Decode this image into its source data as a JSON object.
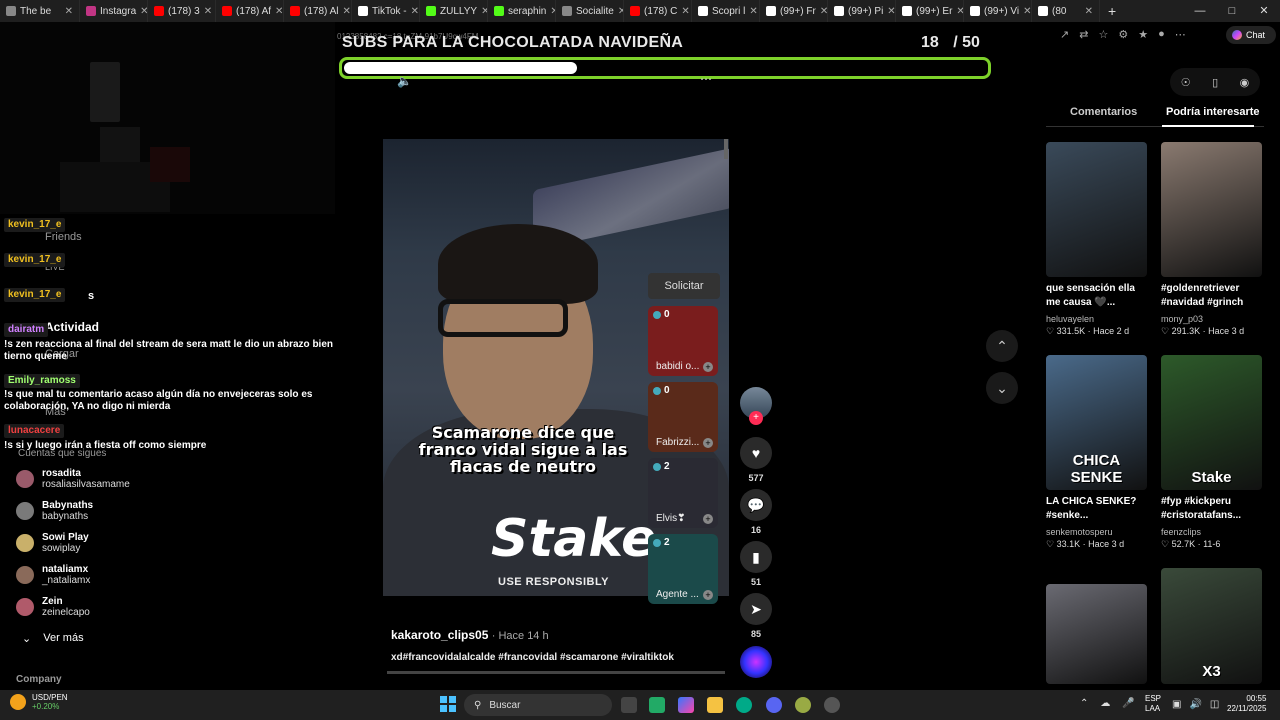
{
  "browser": {
    "tabs": [
      {
        "label": "The be",
        "color": "#888"
      },
      {
        "label": "Instagra",
        "color": "#c13584"
      },
      {
        "label": "(178) 3",
        "color": "#f00"
      },
      {
        "label": "(178) Af",
        "color": "#f00"
      },
      {
        "label": "(178) Al",
        "color": "#f00"
      },
      {
        "label": "TikTok -",
        "color": "#fff"
      },
      {
        "label": "ZULLYY",
        "color": "#53fc18"
      },
      {
        "label": "seraphin",
        "color": "#53fc18"
      },
      {
        "label": "Socialite",
        "color": "#888"
      },
      {
        "label": "(178) C",
        "color": "#f00"
      },
      {
        "label": "Scopri l",
        "color": "#fff"
      },
      {
        "label": "(99+) Fr",
        "color": "#fff"
      },
      {
        "label": "(99+) Pi",
        "color": "#fff"
      },
      {
        "label": "(99+) Er",
        "color": "#fff"
      },
      {
        "label": "(99+) Vi",
        "color": "#fff"
      },
      {
        "label": "(80",
        "color": "#fff"
      }
    ],
    "url_fragment": "0123858482 c=18 t=ZM-91b7U9cw4FM",
    "chat_button": "Chat"
  },
  "goal": {
    "title": "SUBS PARA LA CHOCOLATADA NAVIDEÑA",
    "current": "18",
    "separator": "/",
    "total": "50",
    "progress": 0.36,
    "bar_color": "#7dd12a"
  },
  "stream_chat": [
    {
      "user": "kevin_17_e",
      "user_color": "#f0c020",
      "text": ""
    },
    {
      "user": "kevin_17_e",
      "user_color": "#f0c020",
      "text": ""
    },
    {
      "user": "kevin_17_e",
      "user_color": "#f0c020",
      "text": ""
    },
    {
      "user": "dairatm",
      "user_color": "#d080ff",
      "text": "!s zen reacciona al final del stream de sera matt le dio un abrazo bien tierno queme"
    },
    {
      "user": "Emily_ramoss",
      "user_color": "#a0ff70",
      "text": "!s que mal tu comentario acaso algún día no envejeceras solo es colaboración, YA no digo ni mierda"
    },
    {
      "user": "lunacacere",
      "user_color": "#f04040",
      "text": "!s si y luego irán a fiesta off como siempre"
    }
  ],
  "ghost_nav": {
    "friends": "Friends",
    "live": "LIVE",
    "messages": "s",
    "activity": "Actividad",
    "upload": "Cargar",
    "more": "Más",
    "following_header": "Cuentas que sigues",
    "see_more": "Ver más",
    "company": "Company"
  },
  "following": [
    {
      "name": "rosadita",
      "handle": "rosaliasilvasamame"
    },
    {
      "name": "Babynaths",
      "handle": "babynaths"
    },
    {
      "name": "Sowi Play",
      "handle": "sowiplay"
    },
    {
      "name": "nataliamx",
      "handle": "_nataliamx"
    },
    {
      "name": "Zein",
      "handle": "zeinelcapo"
    }
  ],
  "video": {
    "caption": "Scamarone dice que franco vidal sigue a las flacas de neutro",
    "brand": "Stake",
    "brand_sub": "USE RESPONSIBLY",
    "author": "kakaroto_clips05",
    "time": "· Hace 14 h",
    "tags": "xd#francovidalalcalde #francovidal #scamarone #viraltiktok"
  },
  "live_guests": {
    "request_label": "Solicitar",
    "guests": [
      {
        "count": "0",
        "name": "babidi o...",
        "color": "#7a1d1d"
      },
      {
        "count": "0",
        "name": "Fabrizzi...",
        "color": "#5a2a1a"
      },
      {
        "count": "2",
        "name": "Elvis❣",
        "color": "#2a2a33"
      },
      {
        "count": "2",
        "name": "Agente ...",
        "color": "#1b4a4a"
      }
    ]
  },
  "actions": {
    "likes": "577",
    "comments": "16",
    "saves": "51",
    "shares": "85"
  },
  "right_panel": {
    "tab_comments": "Comentarios",
    "tab_suggested": "Podría interesarte",
    "cards": [
      {
        "title": "que sensación ella me causa 🖤...",
        "user": "heluvayelen",
        "meta": "♡ 331.5K · Hace 2 d",
        "overlay": "",
        "bg": "#3a4a5a"
      },
      {
        "title": "#goldenretriever #navidad #grinch",
        "user": "mony_p03",
        "meta": "♡ 291.3K · Hace 3 d",
        "overlay": "",
        "bg": "#8a7a70"
      },
      {
        "title": "LA CHICA SENKE? #senke...",
        "user": "senkemotosperu",
        "meta": "♡ 33.1K · Hace 3 d",
        "overlay": "CHICA SENKE",
        "bg": "#4a6a8a"
      },
      {
        "title": "#fyp #kickperu #cristoratafans...",
        "user": "feenzclips",
        "meta": "♡ 52.7K · 11-6",
        "overlay": "Stake",
        "bg": "#2d5a2a"
      },
      {
        "title": "",
        "user": "",
        "meta": "",
        "overlay": "",
        "bg": "#6a6a72"
      },
      {
        "title": "",
        "user": "",
        "meta": "",
        "overlay": "X3",
        "bg": "#3a4a3a"
      }
    ]
  },
  "taskbar": {
    "weather_place": "USD/PEN",
    "weather_change": "+0.20%",
    "search": "Buscar",
    "lang1": "ESP",
    "lang2": "LAA",
    "time": "00:55",
    "date": "22/11/2025"
  }
}
